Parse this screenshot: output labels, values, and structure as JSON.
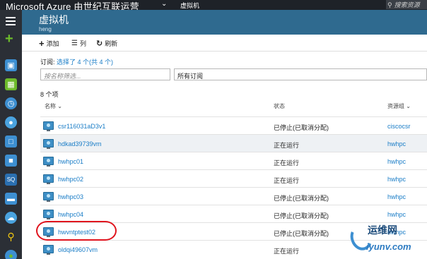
{
  "topbar": {
    "brand": "Microsoft Azure 由世纪互联运营",
    "crumb": "虚拟机",
    "search_placeholder": "搜索资源"
  },
  "blade": {
    "title": "虚拟机",
    "subtitle": "heng"
  },
  "toolbar": {
    "add_label": "添加",
    "columns_label": "列",
    "refresh_label": "刷新"
  },
  "subscription": {
    "prefix": "订阅:",
    "link": "选择了 4 个(共 4 个)"
  },
  "filters": {
    "name_placeholder": "按名称筛选...",
    "subscription_value": "所有订阅"
  },
  "count_label": "8 个项",
  "table": {
    "headers": {
      "name": "名称",
      "status": "状态",
      "resource_group": "资源组"
    },
    "rows": [
      {
        "name": "csr116031aD3v1",
        "status": "已停止(已取消分配)",
        "rg": "ciscocsr"
      },
      {
        "name": "hdkad39739vm",
        "status": "正在运行",
        "rg": "hwhpc"
      },
      {
        "name": "hwhpc01",
        "status": "正在运行",
        "rg": "hwhpc"
      },
      {
        "name": "hwhpc02",
        "status": "正在运行",
        "rg": "hwhpc"
      },
      {
        "name": "hwhpc03",
        "status": "已停止(已取消分配)",
        "rg": "hwhpc"
      },
      {
        "name": "hwhpc04",
        "status": "已停止(已取消分配)",
        "rg": "hwhpc"
      },
      {
        "name": "hwvntptest02",
        "status": "已停止(已取消分配)",
        "rg": "hwhpc"
      },
      {
        "name": "oldqi49607vm",
        "status": "正在运行",
        "rg": ""
      }
    ]
  },
  "watermark": {
    "line1": "运维网",
    "line2": "iyunv.com"
  },
  "colors": {
    "topbar": "#1e2228",
    "rail": "#2b2f36",
    "blade_header": "#2f6a8f",
    "link": "#1a7dc7",
    "highlight_circle": "#e0141e"
  }
}
